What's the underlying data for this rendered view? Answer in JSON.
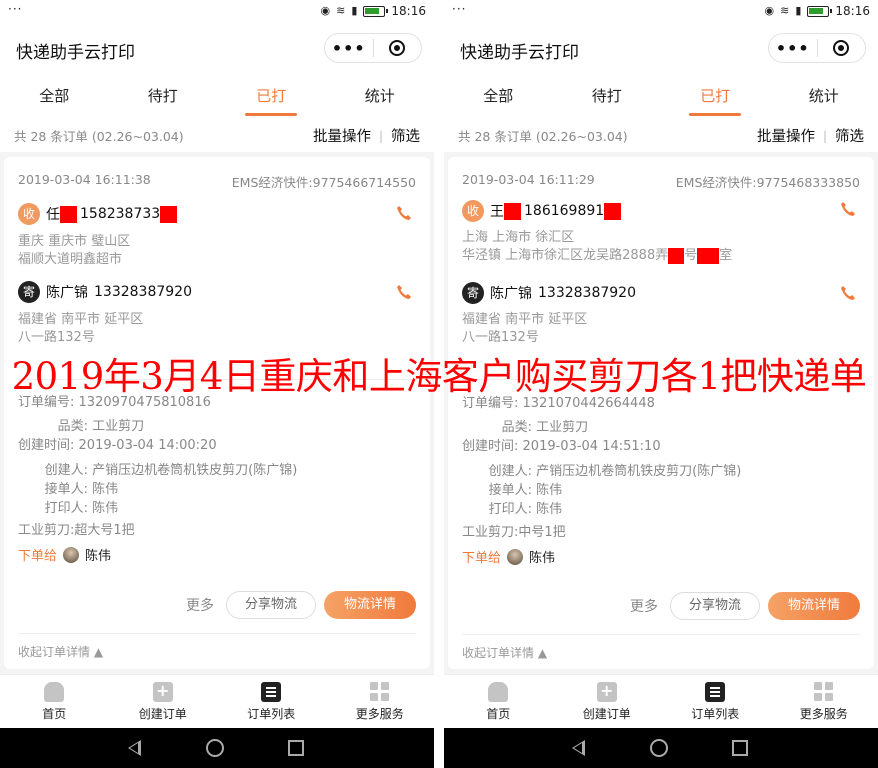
{
  "statusbar": {
    "dots": "···",
    "time": "18:16"
  },
  "app": {
    "title": "快递助手云打印"
  },
  "tabs": [
    {
      "label": "全部"
    },
    {
      "label": "待打"
    },
    {
      "label": "已打",
      "active": true
    },
    {
      "label": "统计"
    }
  ],
  "filter": {
    "count_text": "共 28 条订单 (02.26~03.04)",
    "batch_label": "批量操作",
    "sep": "|",
    "filter_label": "筛选"
  },
  "labels": {
    "recv_badge": "收",
    "send_badge": "寄",
    "order_no": "订单编号:",
    "category": "品类:",
    "created_time": "创建时间:",
    "creator": "创建人:",
    "receiver": "接单人:",
    "printer": "打印人:",
    "assign_to": "下单给",
    "more": "更多",
    "share": "分享物流",
    "detail": "物流详情",
    "collapse": "收起订单详情"
  },
  "orders": [
    {
      "datetime": "2019-03-04 16:11:38",
      "tracking": "EMS经济快件:9775466714550",
      "recipient": {
        "surname": "任",
        "phone": "158238733",
        "region": "重庆 重庆市 璧山区",
        "address": "福顺大道明鑫超市"
      },
      "sender": {
        "name": "陈广锦",
        "phone": "13328387920",
        "region": "福建省 南平市 延平区",
        "address": "八一路132号"
      },
      "order_no": "1320970475810816",
      "category": "工业剪刀",
      "created_time": "2019-03-04 14:00:20",
      "creator": "产销压边机卷筒机铁皮剪刀(陈广锦)",
      "receiver": "陈伟",
      "printer": "陈伟",
      "item_summary": "工业剪刀:超大号1把",
      "assignee": "陈伟"
    },
    {
      "datetime": "2019-03-04 16:11:29",
      "tracking": "EMS经济快件:9775468333850",
      "recipient": {
        "surname": "王",
        "phone": "186169891",
        "region": "上海 上海市 徐汇区",
        "address_a": "华泾镇 上海市徐汇区龙吴路2888弄",
        "address_b": "号",
        "address_c": "室"
      },
      "sender": {
        "name": "陈广锦",
        "phone": "13328387920",
        "region": "福建省 南平市 延平区",
        "address": "八一路132号"
      },
      "order_no": "1321070442664448",
      "category": "工业剪刀",
      "created_time": "2019-03-04 14:51:10",
      "creator": "产销压边机卷筒机铁皮剪刀(陈广锦)",
      "receiver": "陈伟",
      "printer": "陈伟",
      "item_summary": "工业剪刀:中号1把",
      "assignee": "陈伟"
    }
  ],
  "bottomnav": [
    {
      "label": "首页"
    },
    {
      "label": "创建订单"
    },
    {
      "label": "订单列表",
      "active": true
    },
    {
      "label": "更多服务"
    }
  ],
  "overlay_caption": "2019年3月4日重庆和上海客户购买剪刀各1把快递单",
  "colors": {
    "accent": "#f07a3c",
    "redaction": "#ff0000",
    "caption": "#ff0000"
  }
}
